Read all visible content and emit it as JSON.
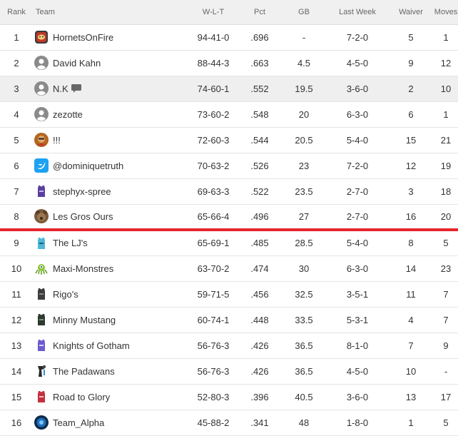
{
  "headers": {
    "rank": "Rank",
    "team": "Team",
    "wlt": "W-L-T",
    "pct": "Pct",
    "gb": "GB",
    "last_week": "Last Week",
    "waiver": "Waiver",
    "moves": "Moves"
  },
  "rows": [
    {
      "rank": "1",
      "team": "HornetsOnFire",
      "wlt": "94-41-0",
      "pct": ".696",
      "gb": "-",
      "last": "7-2-0",
      "waiver": "5",
      "moves": "1"
    },
    {
      "rank": "2",
      "team": "David Kahn",
      "wlt": "88-44-3",
      "pct": ".663",
      "gb": "4.5",
      "last": "4-5-0",
      "waiver": "9",
      "moves": "12"
    },
    {
      "rank": "3",
      "team": "N.K",
      "wlt": "74-60-1",
      "pct": ".552",
      "gb": "19.5",
      "last": "3-6-0",
      "waiver": "2",
      "moves": "10"
    },
    {
      "rank": "4",
      "team": "zezotte",
      "wlt": "73-60-2",
      "pct": ".548",
      "gb": "20",
      "last": "6-3-0",
      "waiver": "6",
      "moves": "1"
    },
    {
      "rank": "5",
      "team": "!!!",
      "wlt": "72-60-3",
      "pct": ".544",
      "gb": "20.5",
      "last": "5-4-0",
      "waiver": "15",
      "moves": "21"
    },
    {
      "rank": "6",
      "team": "@dominiquetruth",
      "wlt": "70-63-2",
      "pct": ".526",
      "gb": "23",
      "last": "7-2-0",
      "waiver": "12",
      "moves": "19"
    },
    {
      "rank": "7",
      "team": "stephyx-spree",
      "wlt": "69-63-3",
      "pct": ".522",
      "gb": "23.5",
      "last": "2-7-0",
      "waiver": "3",
      "moves": "18"
    },
    {
      "rank": "8",
      "team": "Les Gros Ours",
      "wlt": "65-66-4",
      "pct": ".496",
      "gb": "27",
      "last": "2-7-0",
      "waiver": "16",
      "moves": "20"
    },
    {
      "rank": "9",
      "team": "The LJ's",
      "wlt": "65-69-1",
      "pct": ".485",
      "gb": "28.5",
      "last": "5-4-0",
      "waiver": "8",
      "moves": "5"
    },
    {
      "rank": "10",
      "team": "Maxi-Monstres",
      "wlt": "63-70-2",
      "pct": ".474",
      "gb": "30",
      "last": "6-3-0",
      "waiver": "14",
      "moves": "23"
    },
    {
      "rank": "11",
      "team": "Rigo's",
      "wlt": "59-71-5",
      "pct": ".456",
      "gb": "32.5",
      "last": "3-5-1",
      "waiver": "11",
      "moves": "7"
    },
    {
      "rank": "12",
      "team": "Minny Mustang",
      "wlt": "60-74-1",
      "pct": ".448",
      "gb": "33.5",
      "last": "5-3-1",
      "waiver": "4",
      "moves": "7"
    },
    {
      "rank": "13",
      "team": "Knights of Gotham",
      "wlt": "56-76-3",
      "pct": ".426",
      "gb": "36.5",
      "last": "8-1-0",
      "waiver": "7",
      "moves": "9"
    },
    {
      "rank": "14",
      "team": "The Padawans",
      "wlt": "56-76-3",
      "pct": ".426",
      "gb": "36.5",
      "last": "4-5-0",
      "waiver": "10",
      "moves": "-"
    },
    {
      "rank": "15",
      "team": "Road to Glory",
      "wlt": "52-80-3",
      "pct": ".396",
      "gb": "40.5",
      "last": "3-6-0",
      "waiver": "13",
      "moves": "17"
    },
    {
      "rank": "16",
      "team": "Team_Alpha",
      "wlt": "45-88-2",
      "pct": ".341",
      "gb": "48",
      "last": "1-8-0",
      "waiver": "1",
      "moves": "5"
    }
  ],
  "colors": {
    "header_bg": "#f0f0f0",
    "highlight_row": "#efefef",
    "playoff_line": "#e5262b",
    "twitter_blue": "#1da1f2",
    "default_avatar": "#8a8a8a"
  }
}
